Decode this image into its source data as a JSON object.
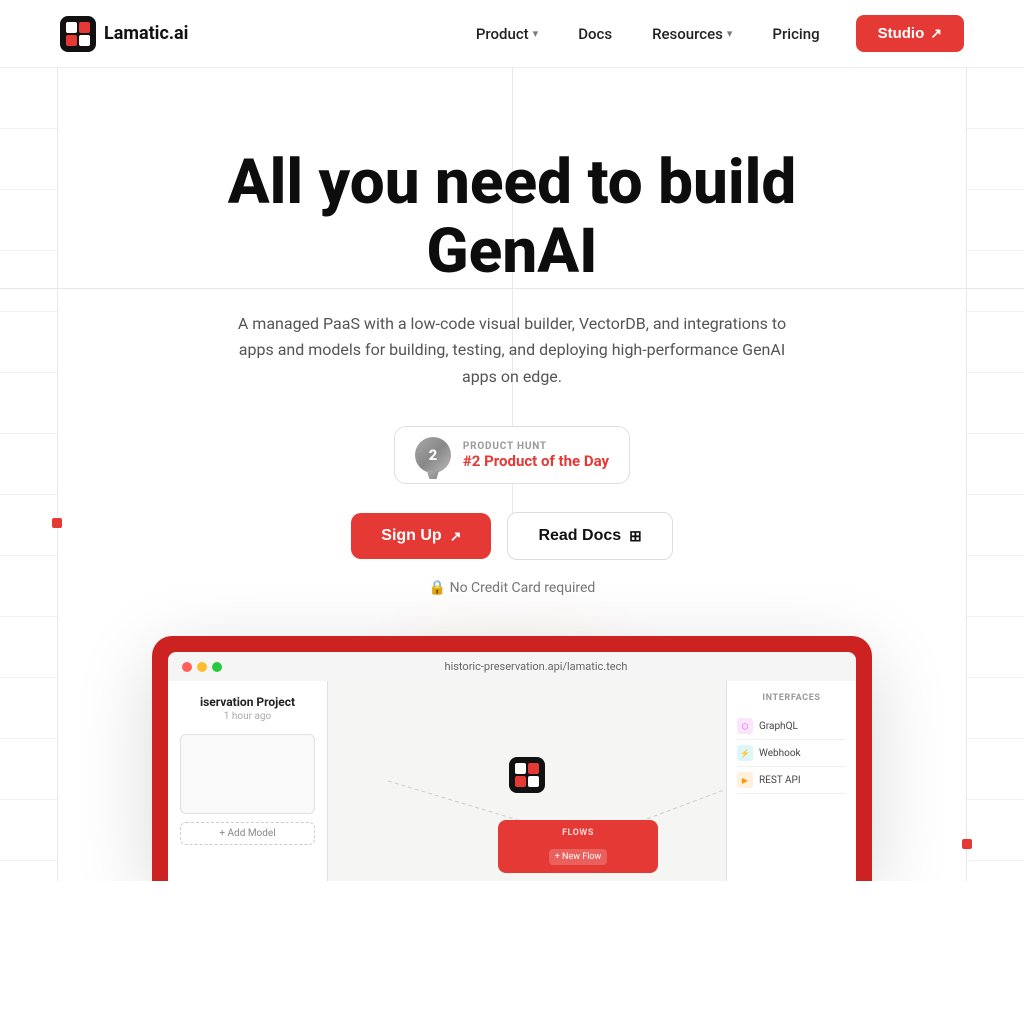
{
  "logo": {
    "name": "Lamatic.ai",
    "icon_alt": "Lamatic logo"
  },
  "nav": {
    "product_label": "Product",
    "docs_label": "Docs",
    "resources_label": "Resources",
    "pricing_label": "Pricing",
    "studio_label": "Studio"
  },
  "hero": {
    "title": "All you need to build GenAI",
    "subtitle": "A managed PaaS with a low-code visual builder, VectorDB, and integrations to apps and models for building, testing, and deploying high-performance GenAI apps on edge.",
    "ph_eyebrow": "PRODUCT HUNT",
    "ph_rank": "#2 Product of the Day",
    "signup_label": "Sign Up",
    "read_docs_label": "Read Docs",
    "no_cc": "🔒 No Credit Card required"
  },
  "app_mockup": {
    "breadcrumb": "historic-preservation.api/lamatic.tech",
    "project_name": "iservation Project",
    "project_time": "1 hour ago",
    "add_model": "+ Add Model",
    "flows_title": "FLOWS",
    "new_flow_btn": "+ New Flow",
    "interfaces_title": "INTERFACES",
    "interface_items": [
      {
        "icon": "G",
        "label": "GraphQL"
      },
      {
        "icon": "⚡",
        "label": "Webhook"
      }
    ]
  }
}
